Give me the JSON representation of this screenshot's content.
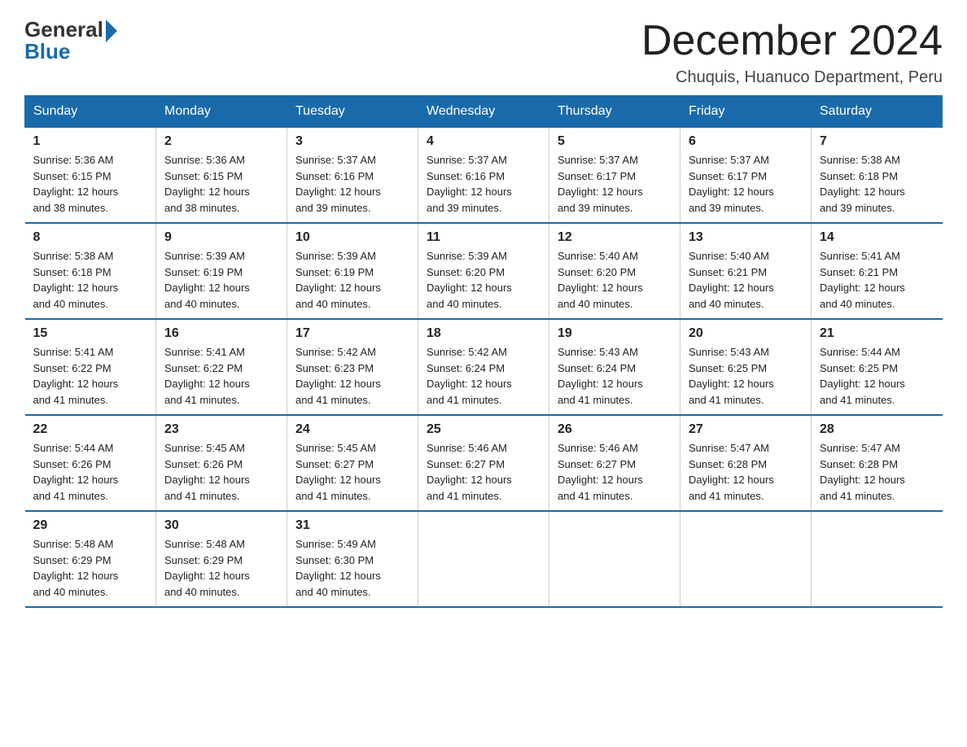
{
  "header": {
    "logo_general": "General",
    "logo_blue": "Blue",
    "title": "December 2024",
    "subtitle": "Chuquis, Huanuco Department, Peru"
  },
  "days_of_week": [
    "Sunday",
    "Monday",
    "Tuesday",
    "Wednesday",
    "Thursday",
    "Friday",
    "Saturday"
  ],
  "weeks": [
    [
      {
        "day": "1",
        "sunrise": "5:36 AM",
        "sunset": "6:15 PM",
        "daylight": "12 hours and 38 minutes."
      },
      {
        "day": "2",
        "sunrise": "5:36 AM",
        "sunset": "6:15 PM",
        "daylight": "12 hours and 38 minutes."
      },
      {
        "day": "3",
        "sunrise": "5:37 AM",
        "sunset": "6:16 PM",
        "daylight": "12 hours and 39 minutes."
      },
      {
        "day": "4",
        "sunrise": "5:37 AM",
        "sunset": "6:16 PM",
        "daylight": "12 hours and 39 minutes."
      },
      {
        "day": "5",
        "sunrise": "5:37 AM",
        "sunset": "6:17 PM",
        "daylight": "12 hours and 39 minutes."
      },
      {
        "day": "6",
        "sunrise": "5:37 AM",
        "sunset": "6:17 PM",
        "daylight": "12 hours and 39 minutes."
      },
      {
        "day": "7",
        "sunrise": "5:38 AM",
        "sunset": "6:18 PM",
        "daylight": "12 hours and 39 minutes."
      }
    ],
    [
      {
        "day": "8",
        "sunrise": "5:38 AM",
        "sunset": "6:18 PM",
        "daylight": "12 hours and 40 minutes."
      },
      {
        "day": "9",
        "sunrise": "5:39 AM",
        "sunset": "6:19 PM",
        "daylight": "12 hours and 40 minutes."
      },
      {
        "day": "10",
        "sunrise": "5:39 AM",
        "sunset": "6:19 PM",
        "daylight": "12 hours and 40 minutes."
      },
      {
        "day": "11",
        "sunrise": "5:39 AM",
        "sunset": "6:20 PM",
        "daylight": "12 hours and 40 minutes."
      },
      {
        "day": "12",
        "sunrise": "5:40 AM",
        "sunset": "6:20 PM",
        "daylight": "12 hours and 40 minutes."
      },
      {
        "day": "13",
        "sunrise": "5:40 AM",
        "sunset": "6:21 PM",
        "daylight": "12 hours and 40 minutes."
      },
      {
        "day": "14",
        "sunrise": "5:41 AM",
        "sunset": "6:21 PM",
        "daylight": "12 hours and 40 minutes."
      }
    ],
    [
      {
        "day": "15",
        "sunrise": "5:41 AM",
        "sunset": "6:22 PM",
        "daylight": "12 hours and 41 minutes."
      },
      {
        "day": "16",
        "sunrise": "5:41 AM",
        "sunset": "6:22 PM",
        "daylight": "12 hours and 41 minutes."
      },
      {
        "day": "17",
        "sunrise": "5:42 AM",
        "sunset": "6:23 PM",
        "daylight": "12 hours and 41 minutes."
      },
      {
        "day": "18",
        "sunrise": "5:42 AM",
        "sunset": "6:24 PM",
        "daylight": "12 hours and 41 minutes."
      },
      {
        "day": "19",
        "sunrise": "5:43 AM",
        "sunset": "6:24 PM",
        "daylight": "12 hours and 41 minutes."
      },
      {
        "day": "20",
        "sunrise": "5:43 AM",
        "sunset": "6:25 PM",
        "daylight": "12 hours and 41 minutes."
      },
      {
        "day": "21",
        "sunrise": "5:44 AM",
        "sunset": "6:25 PM",
        "daylight": "12 hours and 41 minutes."
      }
    ],
    [
      {
        "day": "22",
        "sunrise": "5:44 AM",
        "sunset": "6:26 PM",
        "daylight": "12 hours and 41 minutes."
      },
      {
        "day": "23",
        "sunrise": "5:45 AM",
        "sunset": "6:26 PM",
        "daylight": "12 hours and 41 minutes."
      },
      {
        "day": "24",
        "sunrise": "5:45 AM",
        "sunset": "6:27 PM",
        "daylight": "12 hours and 41 minutes."
      },
      {
        "day": "25",
        "sunrise": "5:46 AM",
        "sunset": "6:27 PM",
        "daylight": "12 hours and 41 minutes."
      },
      {
        "day": "26",
        "sunrise": "5:46 AM",
        "sunset": "6:27 PM",
        "daylight": "12 hours and 41 minutes."
      },
      {
        "day": "27",
        "sunrise": "5:47 AM",
        "sunset": "6:28 PM",
        "daylight": "12 hours and 41 minutes."
      },
      {
        "day": "28",
        "sunrise": "5:47 AM",
        "sunset": "6:28 PM",
        "daylight": "12 hours and 41 minutes."
      }
    ],
    [
      {
        "day": "29",
        "sunrise": "5:48 AM",
        "sunset": "6:29 PM",
        "daylight": "12 hours and 40 minutes."
      },
      {
        "day": "30",
        "sunrise": "5:48 AM",
        "sunset": "6:29 PM",
        "daylight": "12 hours and 40 minutes."
      },
      {
        "day": "31",
        "sunrise": "5:49 AM",
        "sunset": "6:30 PM",
        "daylight": "12 hours and 40 minutes."
      },
      {
        "day": "",
        "sunrise": "",
        "sunset": "",
        "daylight": ""
      },
      {
        "day": "",
        "sunrise": "",
        "sunset": "",
        "daylight": ""
      },
      {
        "day": "",
        "sunrise": "",
        "sunset": "",
        "daylight": ""
      },
      {
        "day": "",
        "sunrise": "",
        "sunset": "",
        "daylight": ""
      }
    ]
  ],
  "labels": {
    "sunrise_prefix": "Sunrise: ",
    "sunset_prefix": "Sunset: ",
    "daylight_prefix": "Daylight: "
  }
}
